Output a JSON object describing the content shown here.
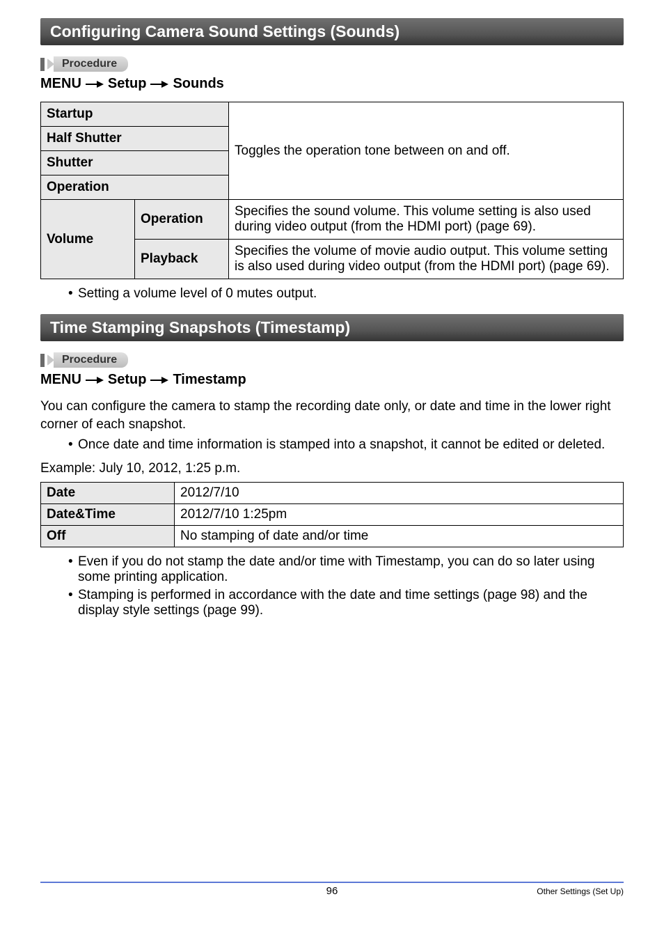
{
  "sections": {
    "sounds": {
      "title": "Configuring Camera Sound Settings (Sounds)",
      "procedure_label": "Procedure",
      "menu_path": {
        "m": "MENU",
        "s1": "Setup",
        "s2": "Sounds"
      },
      "rows": {
        "startup": "Startup",
        "half_shutter": "Half Shutter",
        "shutter": "Shutter",
        "operation": "Operation",
        "toggle_desc": "Toggles the operation tone between on and off.",
        "volume": "Volume",
        "vol_op": "Operation",
        "vol_op_desc": "Specifies the sound volume. This volume setting is also used during video output (from the HDMI port) (page 69).",
        "vol_pb": "Playback",
        "vol_pb_desc": "Specifies the volume of movie audio output. This volume setting is also used during video output (from the HDMI port) (page 69)."
      },
      "note1": "Setting a volume level of 0 mutes output."
    },
    "timestamp": {
      "title": "Time Stamping Snapshots (Timestamp)",
      "procedure_label": "Procedure",
      "menu_path": {
        "m": "MENU",
        "s1": "Setup",
        "s2": "Timestamp"
      },
      "para1": "You can configure the camera to stamp the recording date only, or date and time in the lower right corner of each snapshot.",
      "note_pre": "Once date and time information is stamped into a snapshot, it cannot be edited or deleted.",
      "example_line": "Example: July 10, 2012, 1:25 p.m.",
      "rows": {
        "date": "Date",
        "date_val": "2012/7/10",
        "datetime": "Date&Time",
        "datetime_val": "2012/7/10 1:25pm",
        "off": "Off",
        "off_val": "No stamping of date and/or time"
      },
      "post_notes": {
        "a": "Even if you do not stamp the date and/or time with Timestamp, you can do so later using some printing application.",
        "b": "Stamping is performed in accordance with the date and time settings (page 98) and the display style settings (page 99)."
      }
    }
  },
  "footer": {
    "page": "96",
    "right": "Other Settings (Set Up)"
  }
}
